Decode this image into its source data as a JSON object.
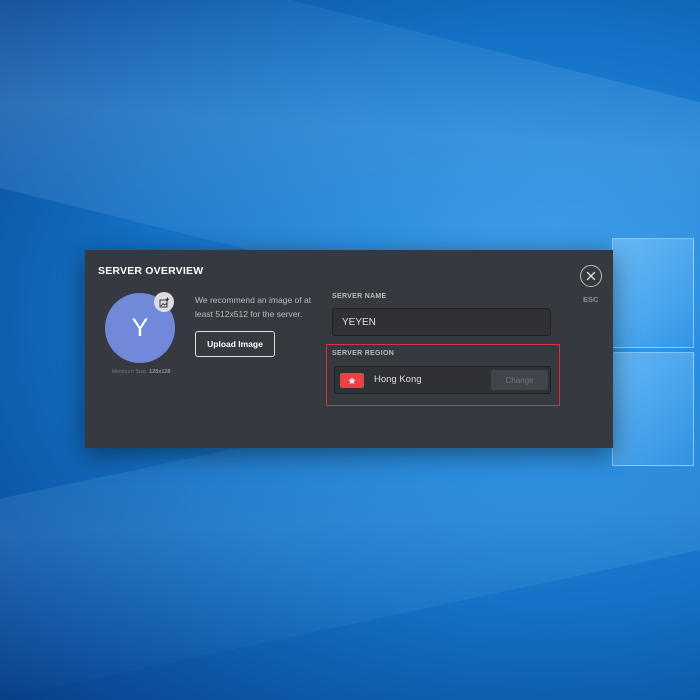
{
  "modal": {
    "title": "SERVER OVERVIEW",
    "esc_label": "ESC"
  },
  "avatar": {
    "initial": "Y",
    "min_size_prefix": "Minimum Size:",
    "min_size_value": "128x128"
  },
  "upload": {
    "recommendation": "We recommend an image of at least 512x512 for the server.",
    "button_label": "Upload Image"
  },
  "server_name": {
    "label": "SERVER NAME",
    "value": "YEYEN"
  },
  "server_region": {
    "label": "SERVER REGION",
    "value": "Hong Kong",
    "change_label": "Change"
  },
  "colors": {
    "modal_bg": "#36393f",
    "avatar": "#7289da",
    "highlight": "#d9313a",
    "flag": "#ed4245"
  },
  "icons": {
    "close": "close-icon",
    "upload": "image-upload-icon",
    "flag": "hong-kong-flag-icon"
  }
}
